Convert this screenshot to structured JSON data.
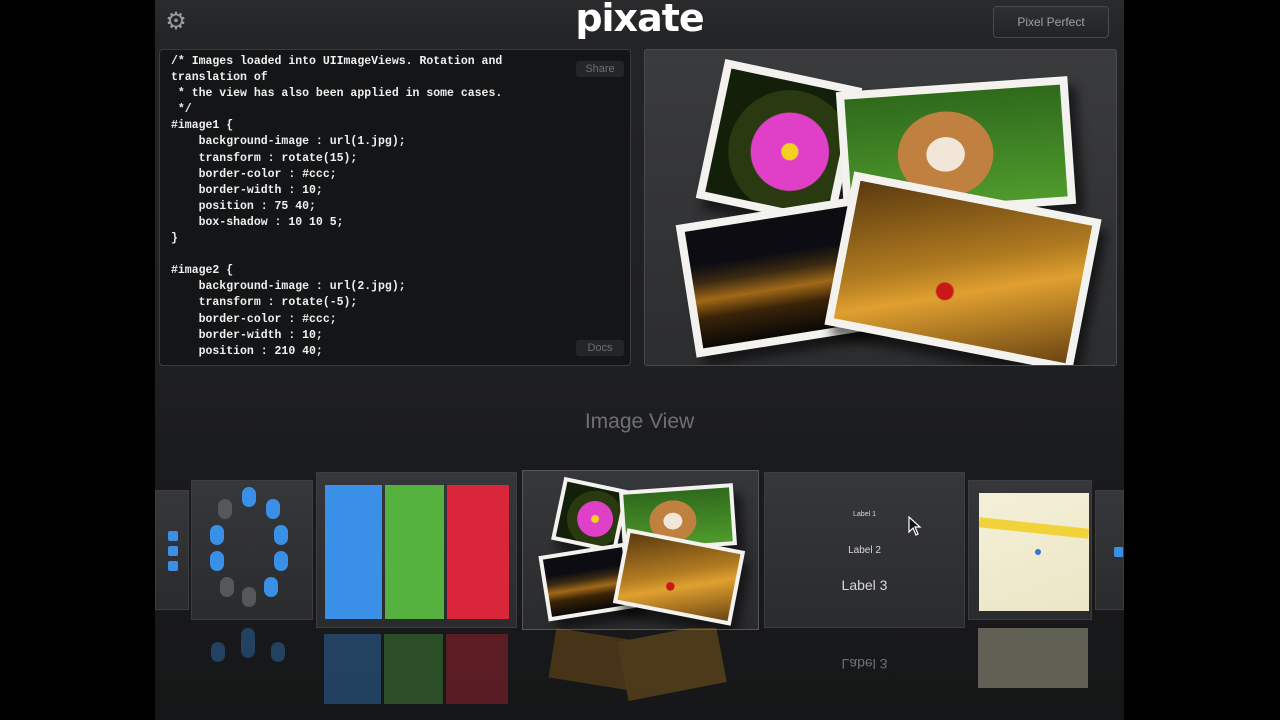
{
  "header": {
    "logo": "pixate",
    "pixel_perfect_label": "Pixel Perfect"
  },
  "editor": {
    "share_label": "Share",
    "docs_label": "Docs",
    "code": "/* Images loaded into UIImageViews. Rotation and\ntranslation of\n * the view has also been applied in some cases.\n */\n#image1 {\n    background-image : url(1.jpg);\n    transform : rotate(15);\n    border-color : #ccc;\n    border-width : 10;\n    position : 75 40;\n    box-shadow : 10 10 5;\n}\n\n#image2 {\n    background-image : url(2.jpg);\n    transform : rotate(-5);\n    border-color : #ccc;\n    border-width : 10;\n    position : 210 40;"
  },
  "section_title": "Image View",
  "carousel": {
    "color_bars": [
      "#3a8fe6",
      "#55b23e",
      "#d9263b"
    ],
    "labels": [
      "Label 1",
      "Label 2",
      "Label 3"
    ],
    "reflected_label": "Label 3"
  },
  "colors": {
    "accent_blue": "#3a8fe6",
    "background": "#232426"
  }
}
